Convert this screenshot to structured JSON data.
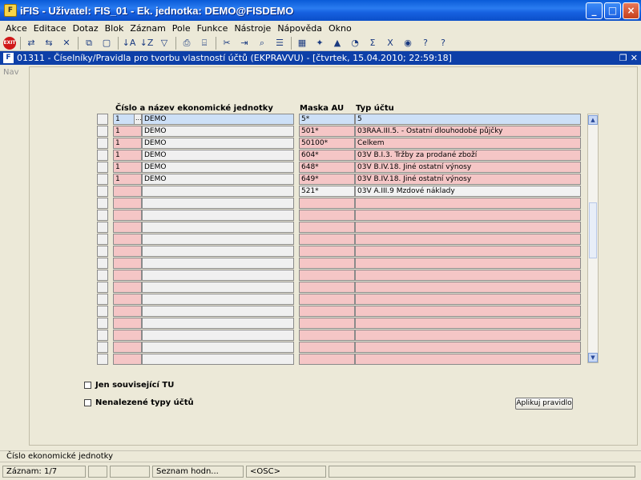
{
  "window": {
    "title": "iFIS - Uživatel: FIS_01 - Ek. jednotka: DEMO@FISDEMO",
    "app_icon": "F",
    "controls": [
      "_",
      "□",
      "×"
    ]
  },
  "menu": [
    "Akce",
    "Editace",
    "Dotaz",
    "Blok",
    "Záznam",
    "Pole",
    "Funkce",
    "Nástroje",
    "Nápověda",
    "Okno"
  ],
  "toolbar": {
    "exit_label": "EXIT",
    "icons": [
      "save-icon",
      "print-save-icon",
      "delete-icon",
      "copy-icon",
      "clear-icon",
      "sort-asc-icon",
      "sort-desc-icon",
      "filter-icon",
      "print-icon",
      "preview-icon",
      "cut-icon",
      "insert-icon",
      "query-icon",
      "list-icon",
      "calendar-icon",
      "tools-icon",
      "warning-icon",
      "help-circle-icon",
      "sigma-icon",
      "excel-icon",
      "globe-icon",
      "help-icon",
      "question-icon"
    ],
    "glyphs": [
      "⇄",
      "⇆",
      "✕",
      "⧉",
      "▢",
      "↓A",
      "↓Z",
      "▽",
      "⎙",
      "⌸",
      "✂",
      "⇥",
      "⌕",
      "☰",
      "▦",
      "✦",
      "▲",
      "◔",
      "Σ",
      "X",
      "◉",
      "?",
      "?"
    ]
  },
  "form": {
    "title": "01311 - Číselníky/Pravidla pro tvorbu vlastností účtů (EKPRAVVU) - [čtvrtek, 15.04.2010; 22:59:18]",
    "icon": "F",
    "nav_label": "Nav",
    "headers": {
      "cislo": "Číslo a název ekonomické jednotky",
      "maska": "Maska AU",
      "typ": "Typ účtu"
    },
    "lov_label": "...",
    "rows": [
      {
        "num": "1",
        "name": "DEMO",
        "mask": "5*",
        "typ": "5"
      },
      {
        "num": "1",
        "name": "DEMO",
        "mask": "501*",
        "typ": "03RAA.III.5. - Ostatní dlouhodobé půjčky"
      },
      {
        "num": "1",
        "name": "DEMO",
        "mask": "50100*",
        "typ": "Celkem"
      },
      {
        "num": "1",
        "name": "DEMO",
        "mask": "604*",
        "typ": "03V B.I.3. Tržby za prodané zboží"
      },
      {
        "num": "1",
        "name": "DEMO",
        "mask": "648*",
        "typ": "03V B.IV.18. Jiné ostatní výnosy"
      },
      {
        "num": "1",
        "name": "DEMO",
        "mask": "649*",
        "typ": "03V B.IV.18. Jiné ostatní výnosy"
      },
      {
        "num": "",
        "name": "",
        "mask": "521*",
        "typ": "03V A.III.9 Mzdové náklady"
      }
    ],
    "empty_rows": 14,
    "checkbox_related": "Jen související TU",
    "checkbox_notfound": "Nenalezené  typy účtů",
    "apply_button": "Aplikuj pravidlo"
  },
  "status": {
    "hint": "Číslo ekonomické jednotky",
    "record": "Záznam: 1/7",
    "list": "Seznam hodn...",
    "osc": "<OSC>"
  }
}
